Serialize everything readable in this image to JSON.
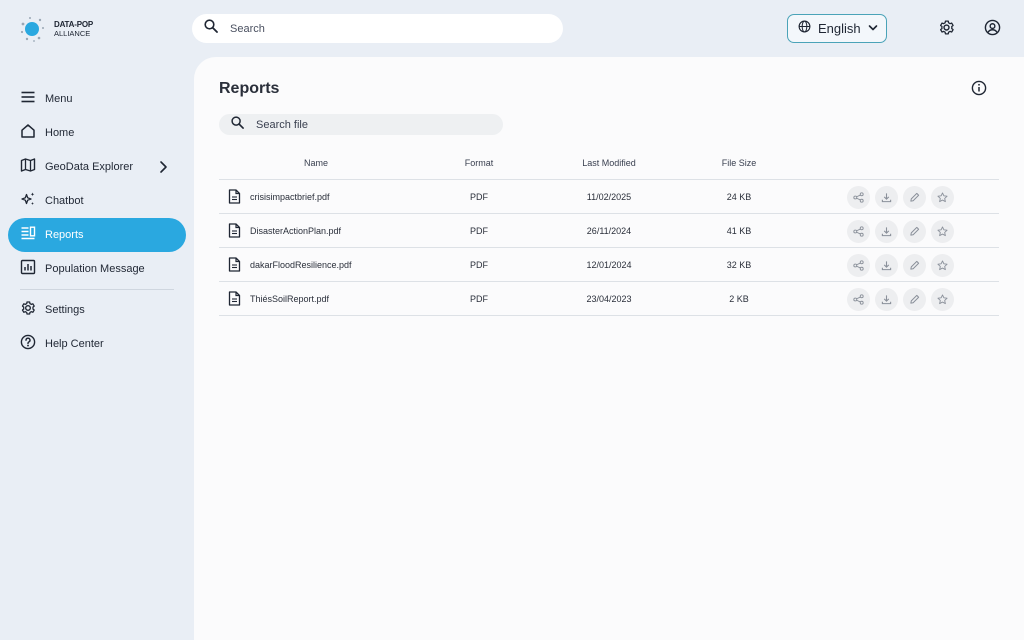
{
  "logo": {
    "line1": "DATA-POP",
    "line2": "ALLIANCE"
  },
  "topbar": {
    "search_placeholder": "Search",
    "language": "English",
    "icons": [
      "search-icon",
      "globe-icon",
      "chevron-down-icon",
      "gear-icon",
      "user-icon"
    ]
  },
  "sidebar": {
    "items": [
      {
        "label": "Menu",
        "icon": "hamburger-icon"
      },
      {
        "label": "Home",
        "icon": "home-icon"
      },
      {
        "label": "GeoData Explorer",
        "icon": "map-icon"
      },
      {
        "label": "Chatbot",
        "icon": "sparkle-icon"
      },
      {
        "label": "Reports",
        "icon": "reports-icon",
        "active": true
      },
      {
        "label": "Population Message",
        "icon": "chart-icon"
      },
      {
        "label": "Settings",
        "icon": "gear-icon"
      },
      {
        "label": "Help Center",
        "icon": "help-icon"
      }
    ]
  },
  "main": {
    "title": "Reports",
    "search_placeholder": "Search file",
    "columns": [
      "Name",
      "Format",
      "Last Modified",
      "File Size"
    ],
    "rows": [
      {
        "name": "crisisimpactbrief.pdf",
        "format": "PDF",
        "modified": "11/02/2025",
        "size": "24 KB"
      },
      {
        "name": "DisasterActionPlan.pdf",
        "format": "PDF",
        "modified": "26/11/2024",
        "size": "41 KB"
      },
      {
        "name": "dakarFloodResilience.pdf",
        "format": "PDF",
        "modified": "12/01/2024",
        "size": "32 KB"
      },
      {
        "name": "ThiésSoilReport.pdf",
        "format": "PDF",
        "modified": "23/04/2023",
        "size": "2 KB"
      }
    ],
    "row_actions": [
      "share-icon",
      "download-icon",
      "edit-icon",
      "star-icon"
    ]
  },
  "colors": {
    "accent": "#2aa8e0",
    "sidebar_bg": "#e9eef5",
    "panel_bg": "#fbfbfc",
    "lang_border": "#4aa3b8"
  }
}
